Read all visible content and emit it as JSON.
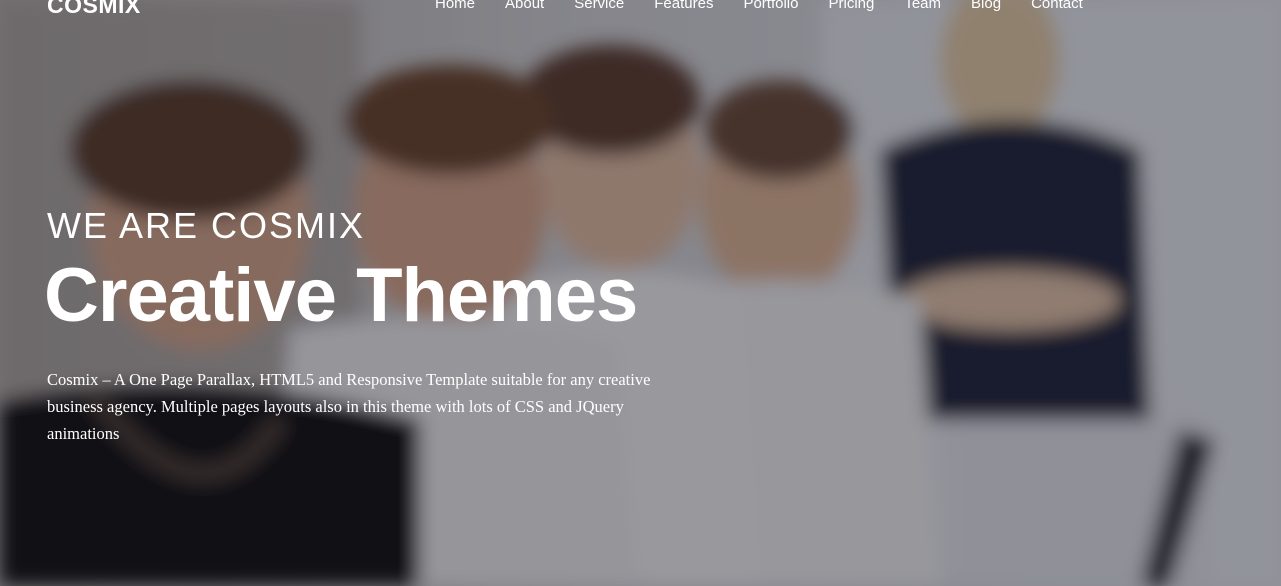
{
  "brand": {
    "logo_text": "COSMIX"
  },
  "nav": {
    "items": [
      {
        "label": "Home"
      },
      {
        "label": "About"
      },
      {
        "label": "Service"
      },
      {
        "label": "Features"
      },
      {
        "label": "Portfolio"
      },
      {
        "label": "Pricing"
      },
      {
        "label": "Team"
      },
      {
        "label": "Blog"
      },
      {
        "label": "Contact"
      }
    ]
  },
  "hero": {
    "kicker": "WE ARE COSMIX",
    "title": "Creative Themes",
    "description": "Cosmix – A One Page Parallax, HTML5 and Responsive Template suitable for any creative business agency. Multiple pages layouts also in this theme with lots of CSS and JQuery animations"
  },
  "colors": {
    "text": "#ffffff",
    "overlay": "#161622"
  }
}
